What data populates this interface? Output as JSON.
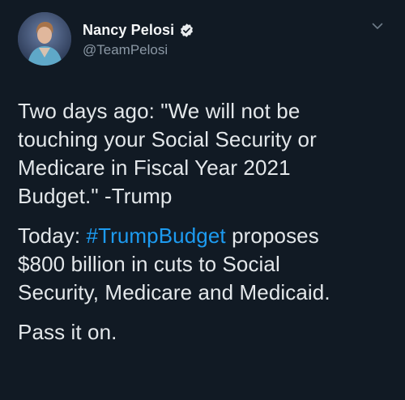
{
  "author": {
    "display_name": "Nancy Pelosi",
    "handle": "@TeamPelosi",
    "verified_icon": "verified-badge-icon",
    "avatar": "avatar-photo"
  },
  "menu_icon": "chevron-down-icon",
  "tweet": {
    "paragraph_1_lines": [
      "Two days ago: \"We will not be",
      "touching your Social Security or",
      "Medicare in Fiscal Year 2021",
      "Budget.\" -Trump"
    ],
    "paragraph_2": {
      "prefix": "Today: ",
      "hashtag": "#TrumpBudget",
      "line1_suffix": " proposes",
      "line2": "$800 billion in cuts to Social",
      "line3": "Security, Medicare and Medicaid."
    },
    "paragraph_3": "Pass it on."
  },
  "colors": {
    "background": "#111a24",
    "hashtag": "#1d9bf0",
    "handle": "#8b98a5"
  }
}
